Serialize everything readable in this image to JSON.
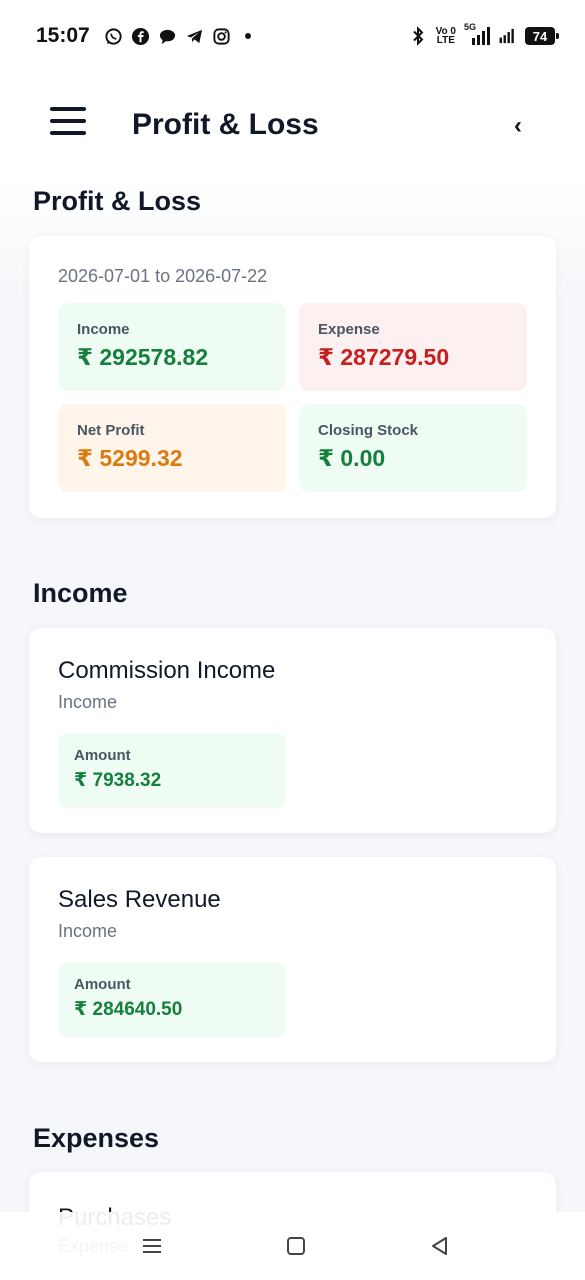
{
  "status_bar": {
    "time": "15:07",
    "notification_icons": [
      "whatsapp-icon",
      "facebook-icon",
      "chat-icon",
      "telegram-icon",
      "instagram-icon",
      "dot-icon"
    ],
    "volte_top": "Vo 0",
    "volte_bottom": "LTE",
    "network": "5G",
    "battery": "74"
  },
  "app_bar": {
    "title": "Profit & Loss",
    "back_glyph": "‹"
  },
  "summary": {
    "section_title": "Profit & Loss",
    "date_range": "2026-07-01 to 2026-07-22",
    "tiles": [
      {
        "label": "Income",
        "value": "₹ 292578.82",
        "color": "#15803d"
      },
      {
        "label": "Expense",
        "value": "₹ 287279.50",
        "color": "#c81e1e"
      },
      {
        "label": "Net Profit",
        "value": "₹ 5299.32",
        "color": "#dd7a0f"
      },
      {
        "label": "Closing Stock",
        "value": "₹ 0.00",
        "color": "#15803d"
      }
    ]
  },
  "income": {
    "section_title": "Income",
    "accounts": [
      {
        "name": "Commission Income",
        "type": "Income",
        "amount_label": "Amount",
        "amount": "₹ 7938.32"
      },
      {
        "name": "Sales Revenue",
        "type": "Income",
        "amount_label": "Amount",
        "amount": "₹ 284640.50"
      }
    ]
  },
  "expenses": {
    "section_title": "Expenses",
    "accounts": [
      {
        "name": "Purchases",
        "type": "Expense"
      }
    ]
  },
  "colors": {
    "primary_text": "#111827",
    "muted_text": "#6b7280",
    "positive": "#15803d",
    "negative": "#c81e1e",
    "warning": "#dd7a0f"
  }
}
